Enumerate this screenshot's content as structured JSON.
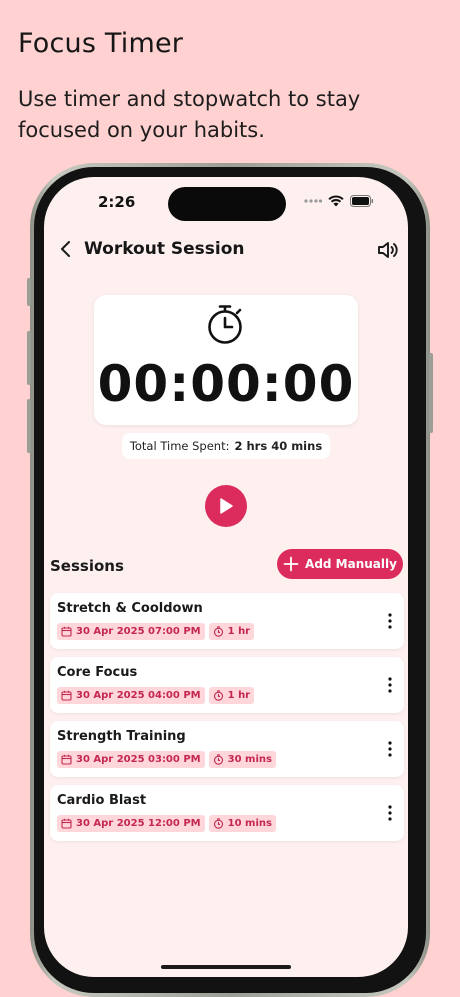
{
  "promo": {
    "title": "Focus Timer",
    "subtitle": "Use timer and stopwatch to stay focused on your habits."
  },
  "status_bar": {
    "time": "2:26"
  },
  "header": {
    "title": "Workout Session"
  },
  "timer": {
    "display": "00:00:00",
    "total_label": "Total Time Spent:",
    "total_value": "2 hrs 40 mins"
  },
  "sessions": {
    "title": "Sessions",
    "add_label": "Add Manually",
    "items": [
      {
        "name": "Stretch & Cooldown",
        "datetime": "30 Apr 2025 07:00 PM",
        "duration": "1 hr"
      },
      {
        "name": "Core Focus",
        "datetime": "30 Apr 2025 04:00 PM",
        "duration": "1 hr"
      },
      {
        "name": "Strength Training",
        "datetime": "30 Apr 2025 03:00 PM",
        "duration": "30 mins"
      },
      {
        "name": "Cardio Blast",
        "datetime": "30 Apr 2025 12:00 PM",
        "duration": "10 mins"
      }
    ]
  },
  "colors": {
    "background": "#ffd1d0",
    "screen": "#fff0f0",
    "accent": "#dc2c5d",
    "tag_bg": "#ffd6d9",
    "tag_text": "#c42850"
  },
  "icons": [
    "back-arrow-icon",
    "speaker-icon",
    "stopwatch-icon",
    "play-icon",
    "plus-icon",
    "calendar-icon",
    "timer-icon",
    "more-vertical-icon",
    "wifi-icon",
    "battery-icon",
    "signal-icon"
  ]
}
